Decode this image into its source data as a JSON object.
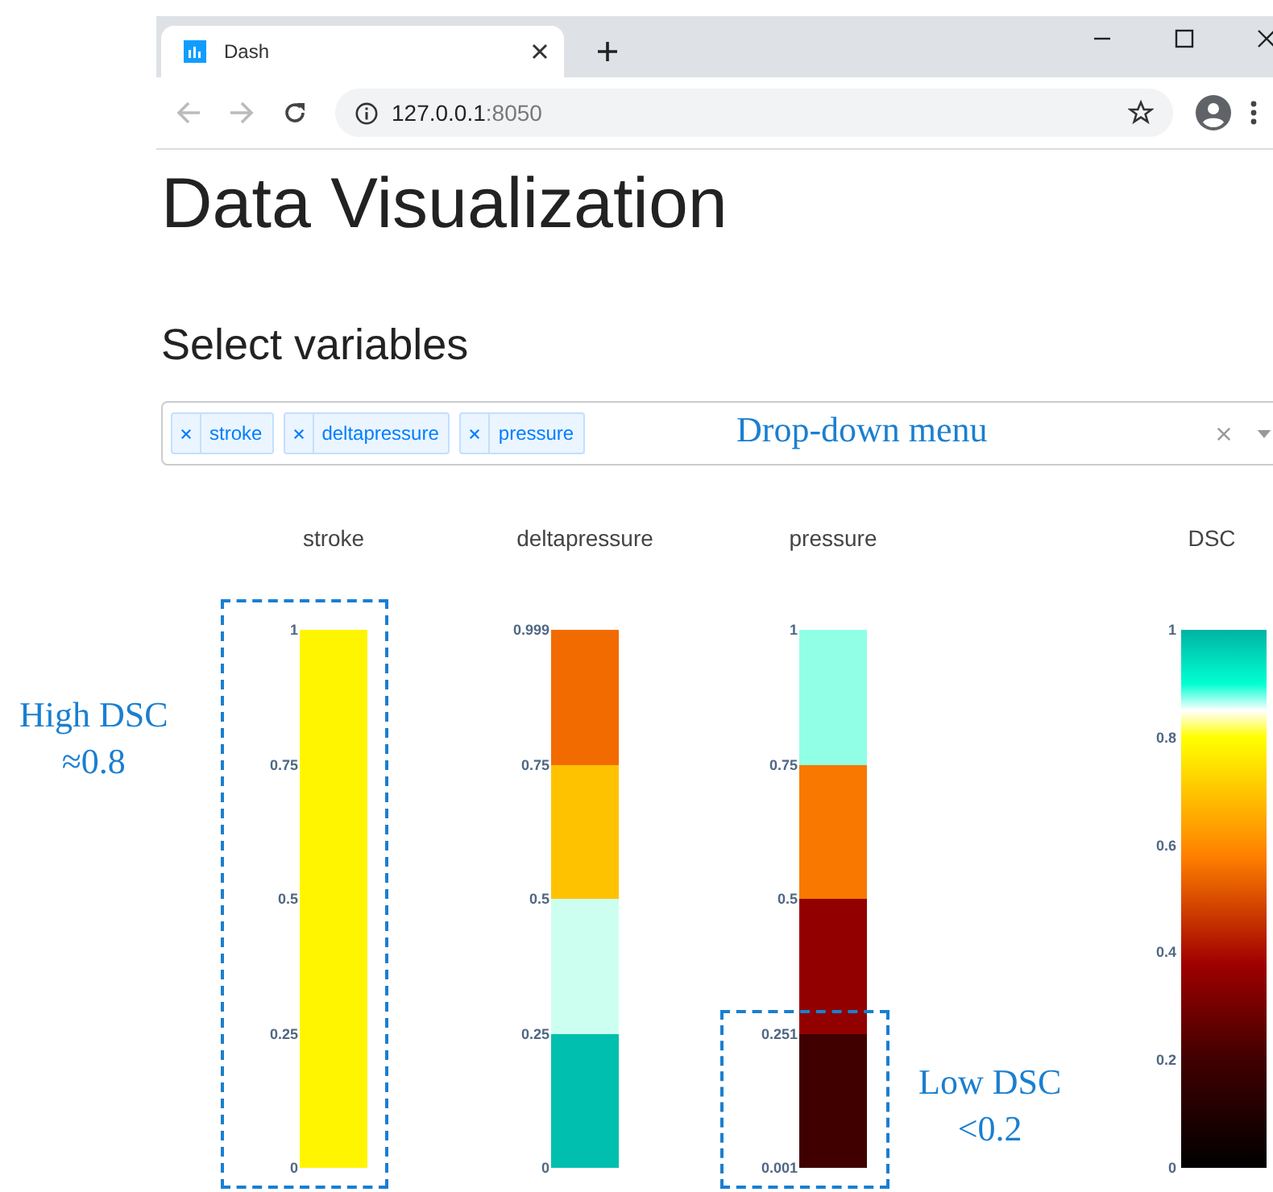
{
  "browser": {
    "tab": {
      "title": "Dash"
    },
    "navigation": {
      "back": {
        "disabled": true
      },
      "forward": {
        "disabled": true
      }
    },
    "address": {
      "host": "127.0.0.1",
      "port": ":8050"
    }
  },
  "page": {
    "title": "Data Visualization",
    "subtitle": "Select variables"
  },
  "dropdown": {
    "chips": [
      {
        "label": "stroke"
      },
      {
        "label": "deltapressure"
      },
      {
        "label": "pressure"
      }
    ]
  },
  "axes": [
    {
      "title": "stroke",
      "kind": "segments",
      "ticks": [
        "1",
        "0.75",
        "0.5",
        "0.25",
        "0"
      ],
      "segments": [
        {
          "color": "#fff500"
        }
      ]
    },
    {
      "title": "deltapressure",
      "kind": "segments",
      "ticks": [
        "0.999",
        "0.75",
        "0.5",
        "0.25",
        "0"
      ],
      "segments": [
        {
          "color": "#f26b00"
        },
        {
          "color": "#ffc200"
        },
        {
          "color": "#ccfff0"
        },
        {
          "color": "#00bfae"
        }
      ]
    },
    {
      "title": "pressure",
      "kind": "segments",
      "ticks": [
        "1",
        "0.75",
        "0.5",
        "0.251",
        "0.001"
      ],
      "segments": [
        {
          "color": "#91ffe6"
        },
        {
          "color": "#f87800"
        },
        {
          "color": "#930000"
        },
        {
          "color": "#400000"
        }
      ]
    },
    {
      "title": "DSC",
      "kind": "gradient",
      "ticks": [
        "1",
        "0.8",
        "0.6",
        "0.4",
        "0.2",
        "0"
      ]
    }
  ],
  "notes": [
    {
      "lines": [
        "Drop-down menu"
      ]
    },
    {
      "lines": [
        "High DSC",
        "≈0.8"
      ]
    },
    {
      "lines": [
        "Low DSC",
        "<0.2"
      ]
    }
  ]
}
